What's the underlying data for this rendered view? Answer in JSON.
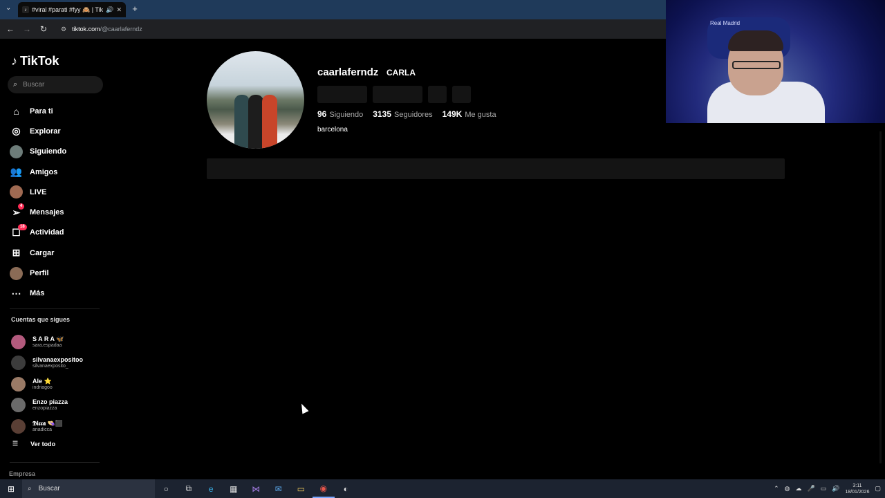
{
  "browser": {
    "tab_title": "#viral #parati #fyy 🙈 | TikTok",
    "new_tab": "+",
    "url_host": "tiktok.com",
    "url_path": "/@caarlaferndz"
  },
  "webcam": {
    "label": "Real Madrid"
  },
  "sidebar": {
    "logo": "TikTok",
    "search_placeholder": "Buscar",
    "nav": [
      {
        "label": "Para ti"
      },
      {
        "label": "Explorar"
      },
      {
        "label": "Siguiendo"
      },
      {
        "label": "Amigos"
      },
      {
        "label": "LIVE"
      },
      {
        "label": "Mensajes",
        "badge": "4"
      },
      {
        "label": "Actividad",
        "badge": "18"
      },
      {
        "label": "Cargar"
      },
      {
        "label": "Perfil"
      },
      {
        "label": "Más"
      }
    ],
    "following_title": "Cuentas que sigues",
    "following": [
      {
        "name": "S A R A 🦋",
        "handle": "sara.espadaa"
      },
      {
        "name": "silvanaexpositoo",
        "handle": "silvanaexposito_"
      },
      {
        "name": "Ale ⭐",
        "handle": "indriagoo"
      },
      {
        "name": "Enzo piazza",
        "handle": "enzopiazza"
      },
      {
        "name": "𝕯𝖎𝖈𝖈𝖆 👒⬛",
        "handle": "anadicca"
      }
    ],
    "see_all": "Ver todo",
    "company": "Empresa"
  },
  "profile": {
    "username": "caarlaferndz",
    "nickname": "CARLA",
    "following_count": "96",
    "following_label": "Siguiendo",
    "followers_count": "3135",
    "followers_label": "Seguidores",
    "likes_count": "149K",
    "likes_label": "Me gusta",
    "bio": "barcelona"
  },
  "taskbar": {
    "search": "Buscar",
    "time": "3:11",
    "date": "18/01/2026"
  }
}
